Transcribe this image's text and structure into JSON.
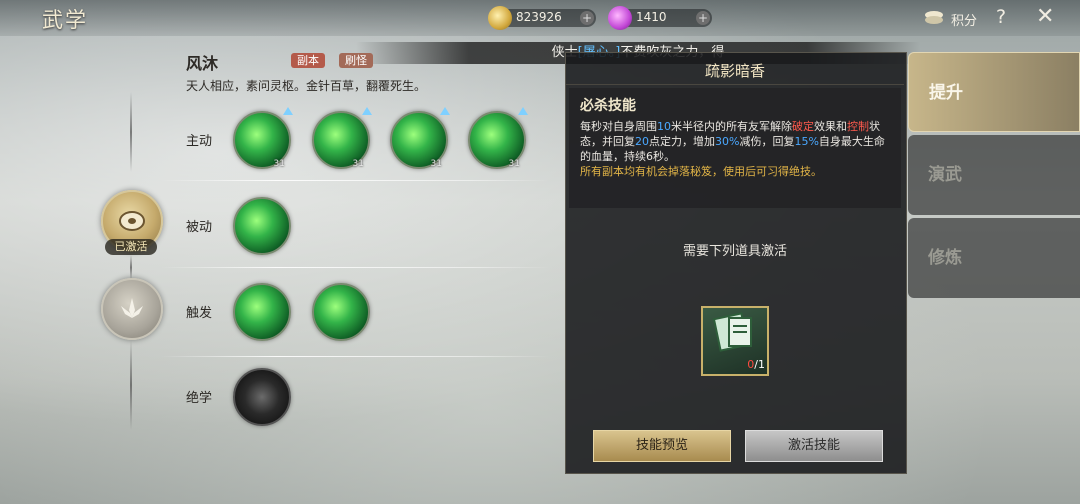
{
  "header": {
    "title": "武学",
    "coins": "823926",
    "gems": "1410",
    "points_label": "积分",
    "help_glyph": "?",
    "close_glyph": "✕"
  },
  "notice": {
    "prefix": "侠士",
    "highlight": "[屠心。]",
    "suffix": "不费吹灰之力，得"
  },
  "school": {
    "name": "风沐",
    "tags": [
      "副本",
      "刷怪"
    ],
    "desc": "天人相应，素问灵枢。金针百草，翻覆死生。"
  },
  "rows": {
    "active": "主动",
    "passive": "被动",
    "trigger": "触发",
    "ultimate": "绝学"
  },
  "active_skills": [
    {
      "level": "31"
    },
    {
      "level": "31"
    },
    {
      "level": "31"
    },
    {
      "level": "31"
    }
  ],
  "badges": {
    "activated_label": "已激活"
  },
  "detail": {
    "title": "疏影暗香",
    "skill_type": "必杀技能",
    "desc_1": "每秒对自身周围",
    "desc_2": "10",
    "desc_3": "米半径内的所有友军解除",
    "desc_4": "破定",
    "desc_5": "效果和",
    "desc_6": "控制",
    "desc_7": "状态，并回复",
    "desc_8": "20",
    "desc_9": "点定力，增加",
    "desc_10": "30%",
    "desc_11": "减伤，回复",
    "desc_12": "15%",
    "desc_13": "自身最大生命的血量，持续6秒。",
    "drop_note": "所有副本均有机会掉落秘笈，使用后可习得绝技。",
    "requirement": "需要下列道具激活",
    "item_have": "0",
    "item_need": "/1",
    "btn_preview": "技能预览",
    "btn_activate": "激活技能"
  },
  "tabs": [
    "提升",
    "演武",
    "修炼"
  ]
}
